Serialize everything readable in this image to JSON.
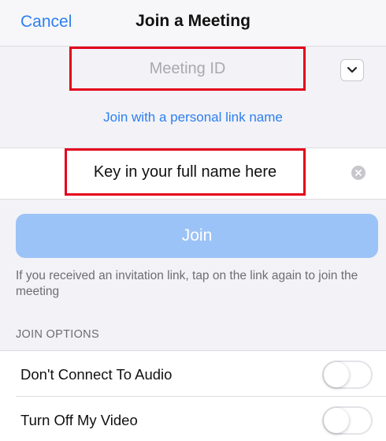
{
  "navbar": {
    "cancel_label": "Cancel",
    "title": "Join a Meeting"
  },
  "meeting": {
    "placeholder": "Meeting ID",
    "dropdown_icon": "chevron-down-icon"
  },
  "personal_link": {
    "label": "Join with a personal link name"
  },
  "name_field": {
    "value": "Key in your full name here",
    "clear_icon": "clear-icon"
  },
  "join": {
    "label": "Join"
  },
  "invite_note": "If you received an invitation link, tap on the link again to join the meeting",
  "options": {
    "header": "JOIN OPTIONS",
    "items": [
      {
        "label": "Don't Connect To Audio",
        "enabled": false
      },
      {
        "label": "Turn Off My Video",
        "enabled": false
      }
    ]
  },
  "colors": {
    "accent": "#2d7ff0",
    "join_disabled": "#9cc3f7",
    "highlight_box": "#e3001b"
  }
}
